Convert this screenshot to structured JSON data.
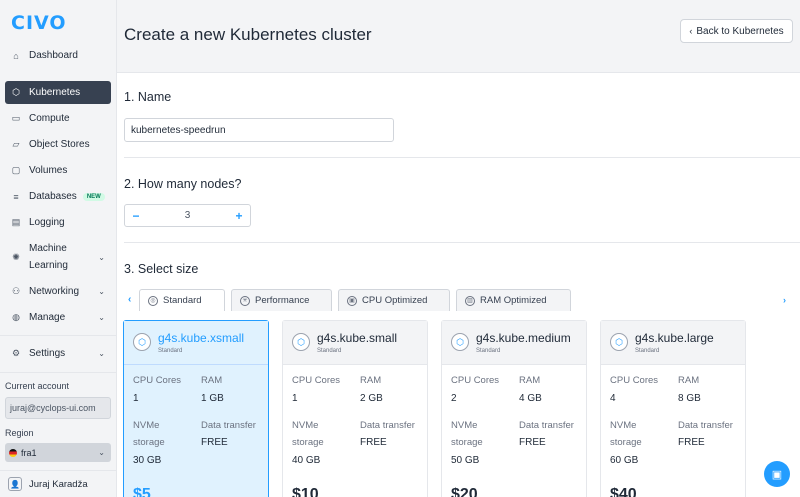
{
  "app": {
    "logo": "CIVO"
  },
  "sidebar": {
    "items": [
      {
        "label": "Dashboard",
        "icon": "home-icon",
        "glyph": "⌂"
      },
      {
        "label": "Kubernetes",
        "icon": "kubernetes-icon",
        "glyph": "⬡",
        "active": true
      },
      {
        "label": "Compute",
        "icon": "compute-icon",
        "glyph": "▭"
      },
      {
        "label": "Object Stores",
        "icon": "folder-icon",
        "glyph": "▱"
      },
      {
        "label": "Volumes",
        "icon": "volume-icon",
        "glyph": "▢"
      },
      {
        "label": "Databases",
        "icon": "database-icon",
        "glyph": "≡",
        "badge": "NEW"
      },
      {
        "label": "Logging",
        "icon": "logging-icon",
        "glyph": "▤"
      },
      {
        "label": "Machine Learning",
        "icon": "ml-icon",
        "glyph": "✺"
      },
      {
        "label": "Networking",
        "icon": "network-icon",
        "glyph": "⚇"
      },
      {
        "label": "Manage",
        "icon": "globe-icon",
        "glyph": "◍"
      },
      {
        "label": "Settings",
        "icon": "gear-icon",
        "glyph": "⚙"
      }
    ],
    "current_account_label": "Current account",
    "current_account": "juraj@cyclops-ui.com",
    "region_label": "Region",
    "region": "fra1",
    "user_name": "Juraj Karadža"
  },
  "header": {
    "title": "Create a new Kubernetes cluster",
    "back_button": "Back to Kubernetes"
  },
  "form": {
    "name_section": "1. Name",
    "name_value": "kubernetes-speedrun",
    "nodes_section": "2. How many nodes?",
    "nodes_value": "3",
    "minus": "−",
    "plus": "+",
    "size_section": "3. Select size"
  },
  "size_tabs": [
    {
      "label": "Standard",
      "active": true
    },
    {
      "label": "Performance"
    },
    {
      "label": "CPU Optimized"
    },
    {
      "label": "RAM Optimized"
    }
  ],
  "card_labels": {
    "cpu": "CPU Cores",
    "ram": "RAM",
    "storage": "NVMe storage",
    "transfer": "Data transfer"
  },
  "sizes": [
    {
      "name": "g4s.kube.xsmall",
      "tier": "Standard",
      "cpu": "1",
      "ram": "1 GB",
      "storage": "30 GB",
      "transfer": "FREE",
      "price": "$5",
      "selected": true
    },
    {
      "name": "g4s.kube.small",
      "tier": "Standard",
      "cpu": "1",
      "ram": "2 GB",
      "storage": "40 GB",
      "transfer": "FREE",
      "price": "$10"
    },
    {
      "name": "g4s.kube.medium",
      "tier": "Standard",
      "cpu": "2",
      "ram": "4 GB",
      "storage": "50 GB",
      "transfer": "FREE",
      "price": "$20"
    },
    {
      "name": "g4s.kube.large",
      "tier": "Standard",
      "cpu": "4",
      "ram": "8 GB",
      "storage": "60 GB",
      "transfer": "FREE",
      "price": "$40"
    }
  ],
  "colors": {
    "accent": "#239dff",
    "sidebar_active": "#374151"
  }
}
